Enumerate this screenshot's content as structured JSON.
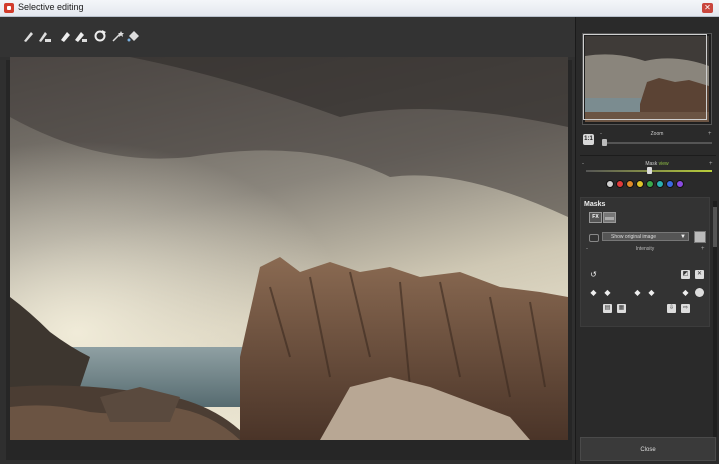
{
  "window": {
    "title": "Selective editing"
  },
  "toolbar": {
    "tools": [
      "brush-icon",
      "brush-plus-icon",
      "eraser-icon",
      "eraser-plus-icon",
      "refresh-brush-icon",
      "magic-wand-icon",
      "fill-bucket-icon"
    ]
  },
  "navigator": {
    "fit_label": "1:1",
    "zoom_label": "Zoom",
    "zoom_minus": "-",
    "zoom_plus": "+",
    "zoom_level": 0.0
  },
  "mask_view": {
    "label": "Mask",
    "hint": "view",
    "minus": "-",
    "plus": "+",
    "level": 0.5,
    "colors": [
      "#d0d0d0",
      "#e03a3a",
      "#e08a2a",
      "#e0c52a",
      "#3aa84a",
      "#2ab0b0",
      "#3a6ae0",
      "#8a4ae0"
    ]
  },
  "masks": {
    "title": "Masks",
    "fx_label": "FX",
    "show_select": "Show original image",
    "intensity_label": "Intensity",
    "intensity_minus": "-",
    "intensity_plus": "+"
  },
  "footer": {
    "close_label": "Close"
  }
}
